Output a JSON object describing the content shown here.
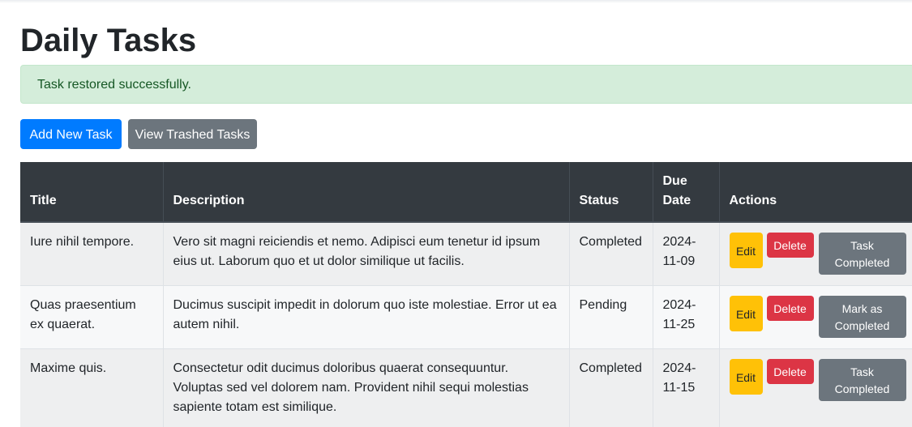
{
  "page": {
    "title": "Daily Tasks",
    "alert": "Task restored successfully."
  },
  "toolbar": {
    "add_label": "Add New Task",
    "trash_label": "View Trashed Tasks"
  },
  "colors": {
    "primary": "#007bff",
    "secondary": "#6c757d",
    "warning": "#ffc107",
    "danger": "#dc3545",
    "success_bg": "#d4edda",
    "success_text": "#155724",
    "table_header": "#343a40"
  },
  "table": {
    "headers": {
      "title": "Title",
      "description": "Description",
      "status": "Status",
      "due_date_1": "Due",
      "due_date_2": "Date",
      "actions": "Actions"
    },
    "rows": [
      {
        "title": "Iure nihil tempore.",
        "description": "Vero sit magni reiciendis et nemo. Adipisci eum tenetur id ipsum eius ut. Laborum quo et ut dolor similique ut facilis.",
        "status": "Completed",
        "due_1": "2024-",
        "due_2": "11-09",
        "edit": "Edit",
        "delete": "Delete",
        "complete_1": "Task",
        "complete_2": "Completed"
      },
      {
        "title": "Quas praesentium ex quaerat.",
        "description": "Ducimus suscipit impedit in dolorum quo iste molestiae. Error ut ea autem nihil.",
        "status": "Pending",
        "due_1": "2024-",
        "due_2": "11-25",
        "edit": "Edit",
        "delete": "Delete",
        "complete_1": "Mark as",
        "complete_2": "Completed"
      },
      {
        "title": "Maxime quis.",
        "description": "Consectetur odit ducimus doloribus quaerat consequuntur. Voluptas sed vel dolorem nam. Provident nihil sequi molestias sapiente totam est similique.",
        "status": "Completed",
        "due_1": "2024-",
        "due_2": "11-15",
        "edit": "Edit",
        "delete": "Delete",
        "complete_1": "Task",
        "complete_2": "Completed"
      }
    ]
  }
}
